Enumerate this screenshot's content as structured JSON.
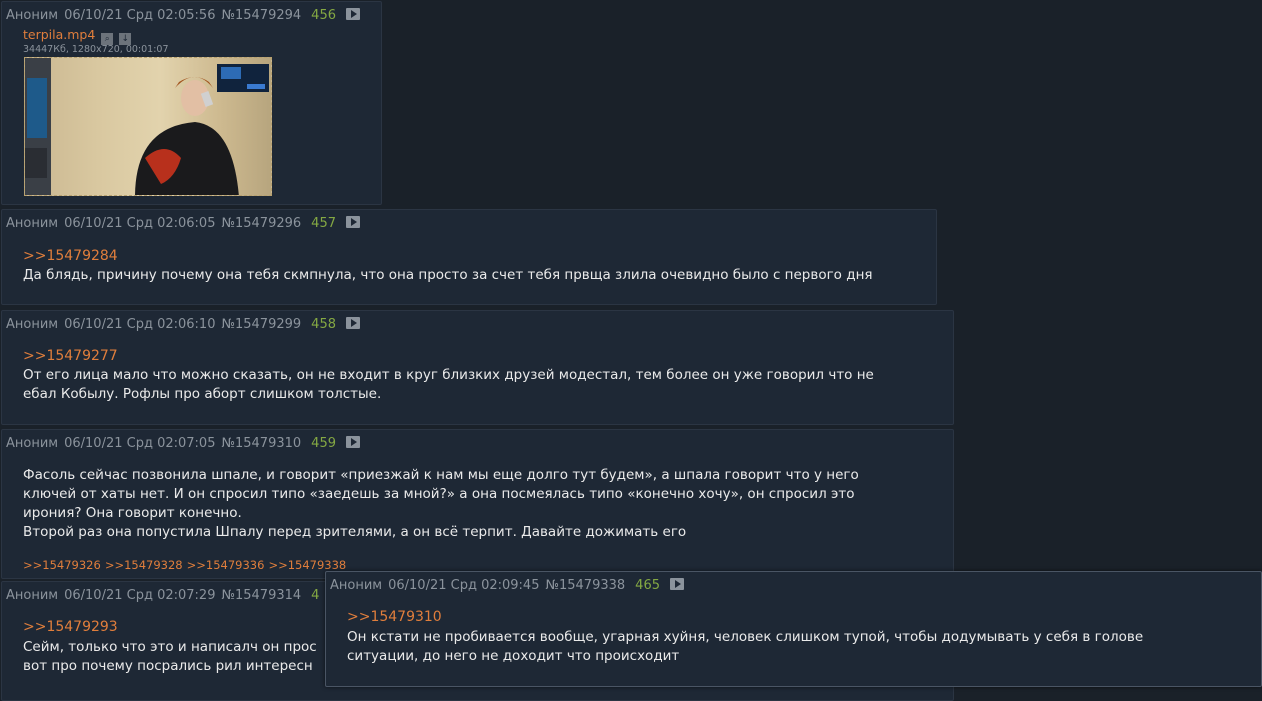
{
  "posts": [
    {
      "author": "Аноним",
      "date": "06/10/21 Срд 02:05:56",
      "number": "№15479294",
      "count": "456",
      "file": {
        "name": "terpila.mp4",
        "meta": "34447Кб, 1280x720, 00:01:07"
      }
    },
    {
      "author": "Аноним",
      "date": "06/10/21 Срд 02:06:05",
      "number": "№15479296",
      "count": "457",
      "reply": ">>15479284",
      "lines": [
        "Да блядь, причину почему она тебя скмпнула, что она просто за счет тебя првща злила очевидно было с первого дня"
      ]
    },
    {
      "author": "Аноним",
      "date": "06/10/21 Срд 02:06:10",
      "number": "№15479299",
      "count": "458",
      "reply": ">>15479277",
      "lines": [
        "От его лица мало что можно сказать, он не входит в круг близких друзей модестал, тем более он уже говорил что не",
        "ебал Кобылу. Рофлы про аборт слишком толстые."
      ]
    },
    {
      "author": "Аноним",
      "date": "06/10/21 Срд 02:07:05",
      "number": "№15479310",
      "count": "459",
      "lines": [
        "Фасоль сейчас позвонила шпале, и говорит «приезжай к нам мы еще долго тут будем», а шпала говорит что у него",
        "ключей от хаты нет. И он спросил типо «заедешь за мной?» а она посмеялась типо «конечно хочу», он спросил это",
        "ирония? Она говорит конечно.",
        "Второй раз она попустила Шпалу перед зрителями, а он всё терпит. Давайте дожимать его"
      ],
      "backlinks": [
        ">>15479326",
        ">>15479328",
        ">>15479336",
        ">>15479338"
      ]
    },
    {
      "author": "Аноним",
      "date": "06/10/21 Срд 02:07:29",
      "number": "№15479314",
      "count": "4",
      "reply": ">>15479293",
      "lines": [
        "Сейм, только что это и написалч он прос",
        "вот про почему посрались рил интересн"
      ]
    }
  ],
  "popup": {
    "author": "Аноним",
    "date": "06/10/21 Срд 02:09:45",
    "number": "№15479338",
    "count": "465",
    "reply": ">>15479310",
    "lines": [
      "Он кстати не пробивается вообще, угарная хуйня, человек слишком тупой, чтобы додумывать у себя в голове",
      "ситуации, до него не доходит что происходит"
    ]
  },
  "icons": {
    "play": "play-icon",
    "search": "search-icon",
    "download": "download-icon"
  },
  "colors": {
    "background": "#1a2129",
    "post": "#1e2835",
    "link": "#e07e3c",
    "count": "#84a843",
    "meta": "#8b939c"
  }
}
